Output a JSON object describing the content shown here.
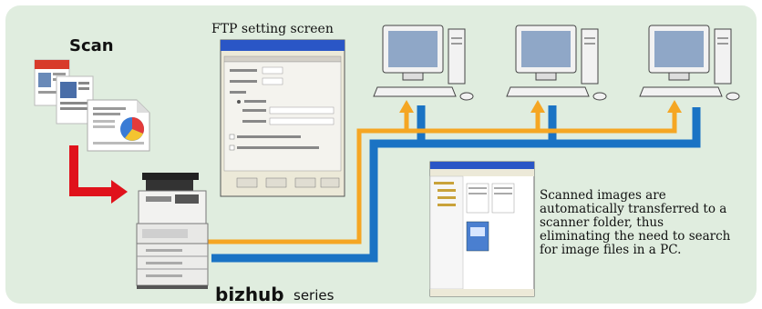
{
  "scan_label": "Scan",
  "ftp_screen_title": "FTP setting screen",
  "brand": "bizhub",
  "brand_suffix": "series",
  "description": "Scanned images are automatically transferred to a scanner folder, thus eliminating the need to search for image files in a PC.",
  "colors": {
    "background": "#e0eddf",
    "network_line_blue": "#1a73c4",
    "network_line_orange": "#f5a623",
    "scan_arrow_red": "#e0121b"
  },
  "icons": {
    "documents": "scanned-documents-icon",
    "mfp": "bizhub-mfp-icon",
    "pc": "desktop-pc-icon"
  }
}
